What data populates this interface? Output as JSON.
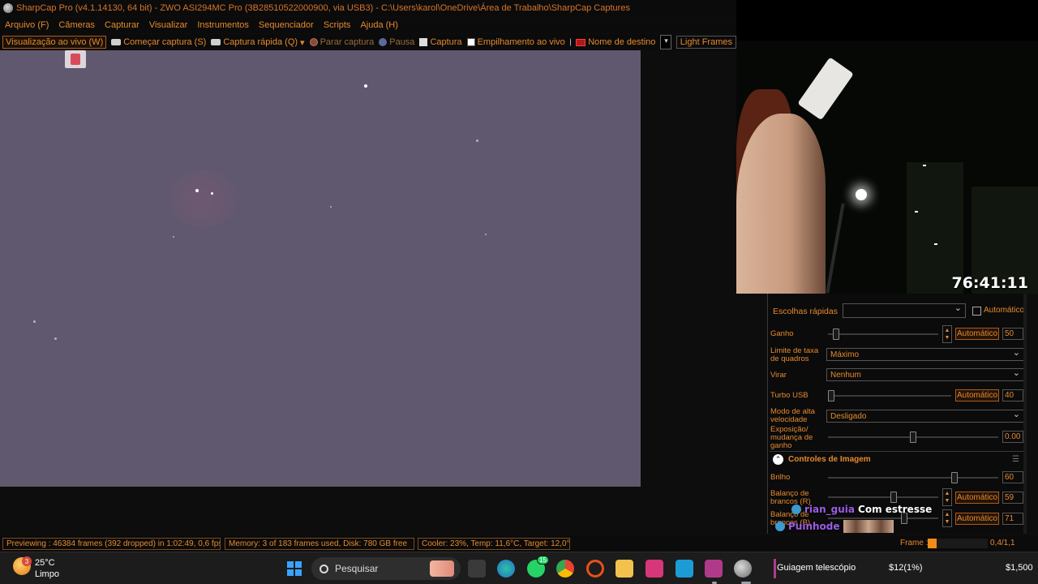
{
  "window": {
    "title": "SharpCap Pro (v4.1.14130, 64 bit) - ZWO ASI294MC Pro (3B28510522000900, via USB3) - C:\\Users\\karol\\OneDrive\\Área de Trabalho\\SharpCap Captures"
  },
  "menu": [
    "Arquivo (F)",
    "Câmeras",
    "Capturar",
    "Visualizar",
    "Instrumentos",
    "Sequenciador",
    "Scripts",
    "Ajuda (H)"
  ],
  "toolbar": {
    "live_view": "Visualização ao vivo (W)",
    "start_capture": "Começar captura (S)",
    "quick_capture": "Captura rápida (Q)",
    "stop_capture": "Parar captura",
    "pause": "Pausa",
    "capture": "Captura",
    "live_stacking": "Empilhamento ao vivo",
    "target_name": "Nome de destino",
    "target_value": "",
    "frame_type": "Light Frames"
  },
  "stream": {
    "timer": "76:41:11"
  },
  "controls": {
    "quick_picks_label": "Escolhas rápidas",
    "quick_picks_value": "",
    "auto_label": "Automático",
    "gain": {
      "label": "Ganho",
      "auto": "Automático",
      "value": "50",
      "level": 0.05
    },
    "frame_rate_limit": {
      "label": "Limite de taxa de quadros",
      "value": "Máximo"
    },
    "flip": {
      "label": "Virar",
      "value": "Nenhum"
    },
    "turbo_usb": {
      "label": "Turbo USB",
      "auto": "Automático",
      "value": "40",
      "level": 0.0
    },
    "high_speed_mode": {
      "label": "Modo de alta velocidade",
      "value": "Desligado"
    },
    "exposure_gain_change": {
      "label": "Exposição/ mudança de ganho",
      "value": "0.00",
      "level": 0.5
    },
    "image_controls": {
      "title": "Controles de Imagem",
      "brightness": {
        "label": "Brilho",
        "value": "60",
        "level": 0.75
      },
      "wb_red": {
        "label": "Balanço de brancos (R)",
        "auto": "Automático",
        "value": "59",
        "level": 0.6
      },
      "wb_blue": {
        "label": "Balanço de brancos (B)",
        "auto": "Automático",
        "value": "71",
        "level": 0.7
      }
    }
  },
  "chat": [
    {
      "user": "rian_guia",
      "message": "Com estresse"
    },
    {
      "user": "Puinhode",
      "message": ""
    }
  ],
  "status": {
    "previewing": "Previewing : 46384 frames (392 dropped) in 1:02:49, 0,6 fps",
    "memory": "Memory: 3 of 183 frames used, Disk: 780 GB free",
    "cooler": "Cooler: 23%, Temp: 11,6°C, Target: 12,0°C",
    "frame_label": "Frame :",
    "frame_value": "0,4/1,1",
    "frame_progress": 0.15
  },
  "taskbar": {
    "weather_badge": "3",
    "temperature": "25°C",
    "weather": "Limpo",
    "search": "Pesquisar",
    "whatsapp_badge": "15",
    "ticker_name": "Guiagem telescópio",
    "ticker_change": "$12(1%)",
    "ticker_price": "$1,500"
  },
  "colors": {
    "accent": "#e68a2e",
    "preview_bg": "#5f586e",
    "chat_user": "#9b5de5",
    "frame_fill": "#f08c1a"
  },
  "icons": [
    "sharpcap-icon",
    "camera-icon",
    "stop-icon",
    "pause-icon",
    "capture-icon",
    "stack-icon",
    "film-icon",
    "windows-start-icon",
    "search-icon",
    "edge-icon",
    "whatsapp-icon",
    "chrome-icon",
    "opera-icon",
    "folder-icon",
    "app-icon"
  ]
}
